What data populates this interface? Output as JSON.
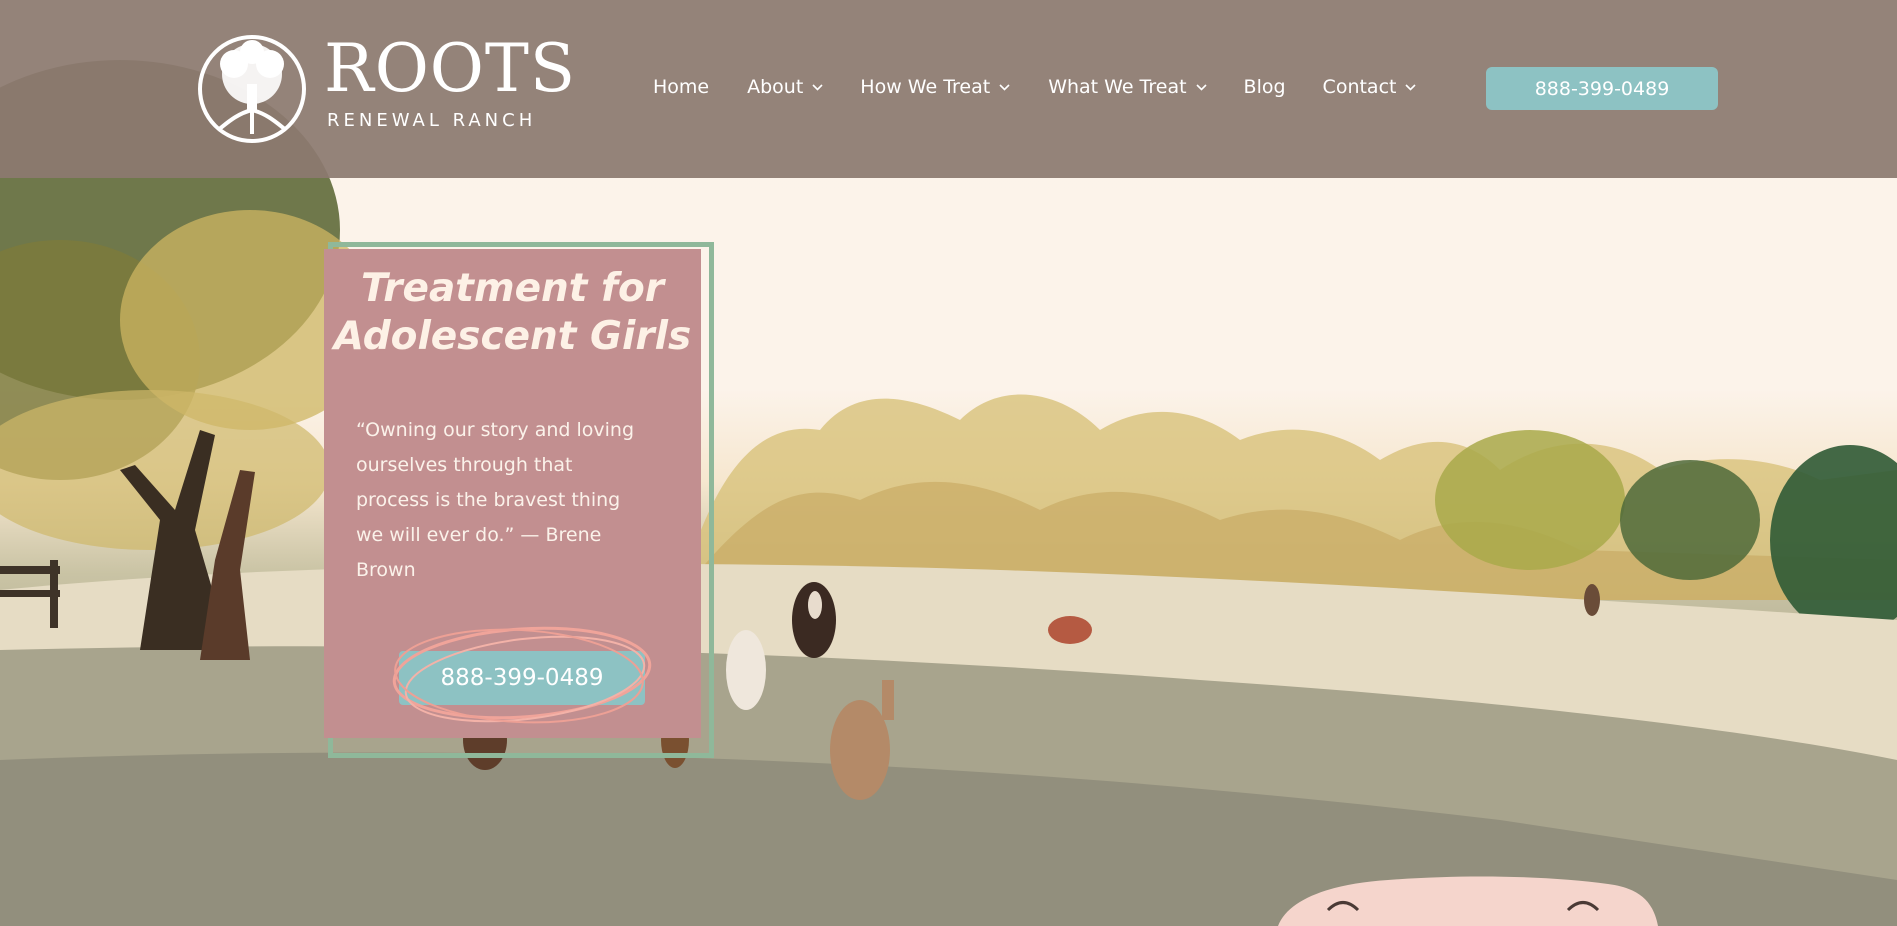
{
  "brand": {
    "name": "ROOTS",
    "tagline": "RENEWAL RANCH"
  },
  "nav": {
    "items": [
      {
        "label": "Home",
        "has_dropdown": false
      },
      {
        "label": "About",
        "has_dropdown": true
      },
      {
        "label": "How We Treat",
        "has_dropdown": true
      },
      {
        "label": "What We Treat",
        "has_dropdown": true
      },
      {
        "label": "Blog",
        "has_dropdown": false
      },
      {
        "label": "Contact",
        "has_dropdown": true
      }
    ],
    "phone": "888-399-0489"
  },
  "hero": {
    "title_line1": "Treatment for",
    "title_line2": "Adolescent Girls",
    "quote_lines": [
      "“Owning our story and loving",
      "ourselves through that",
      "process is the bravest thing",
      "we will ever do.” — Brene",
      "Brown"
    ],
    "cta_phone": "888-399-0489"
  },
  "colors": {
    "header_bg": "#8c7a70",
    "card_bg": "#c28f90",
    "accent_teal": "#8dc2c3",
    "card_border_green": "#8fb89a",
    "scribble_pink": "#f0a49a"
  },
  "icons": {
    "logo": "tree-of-life-icon",
    "dropdown": "chevron-down-icon"
  }
}
